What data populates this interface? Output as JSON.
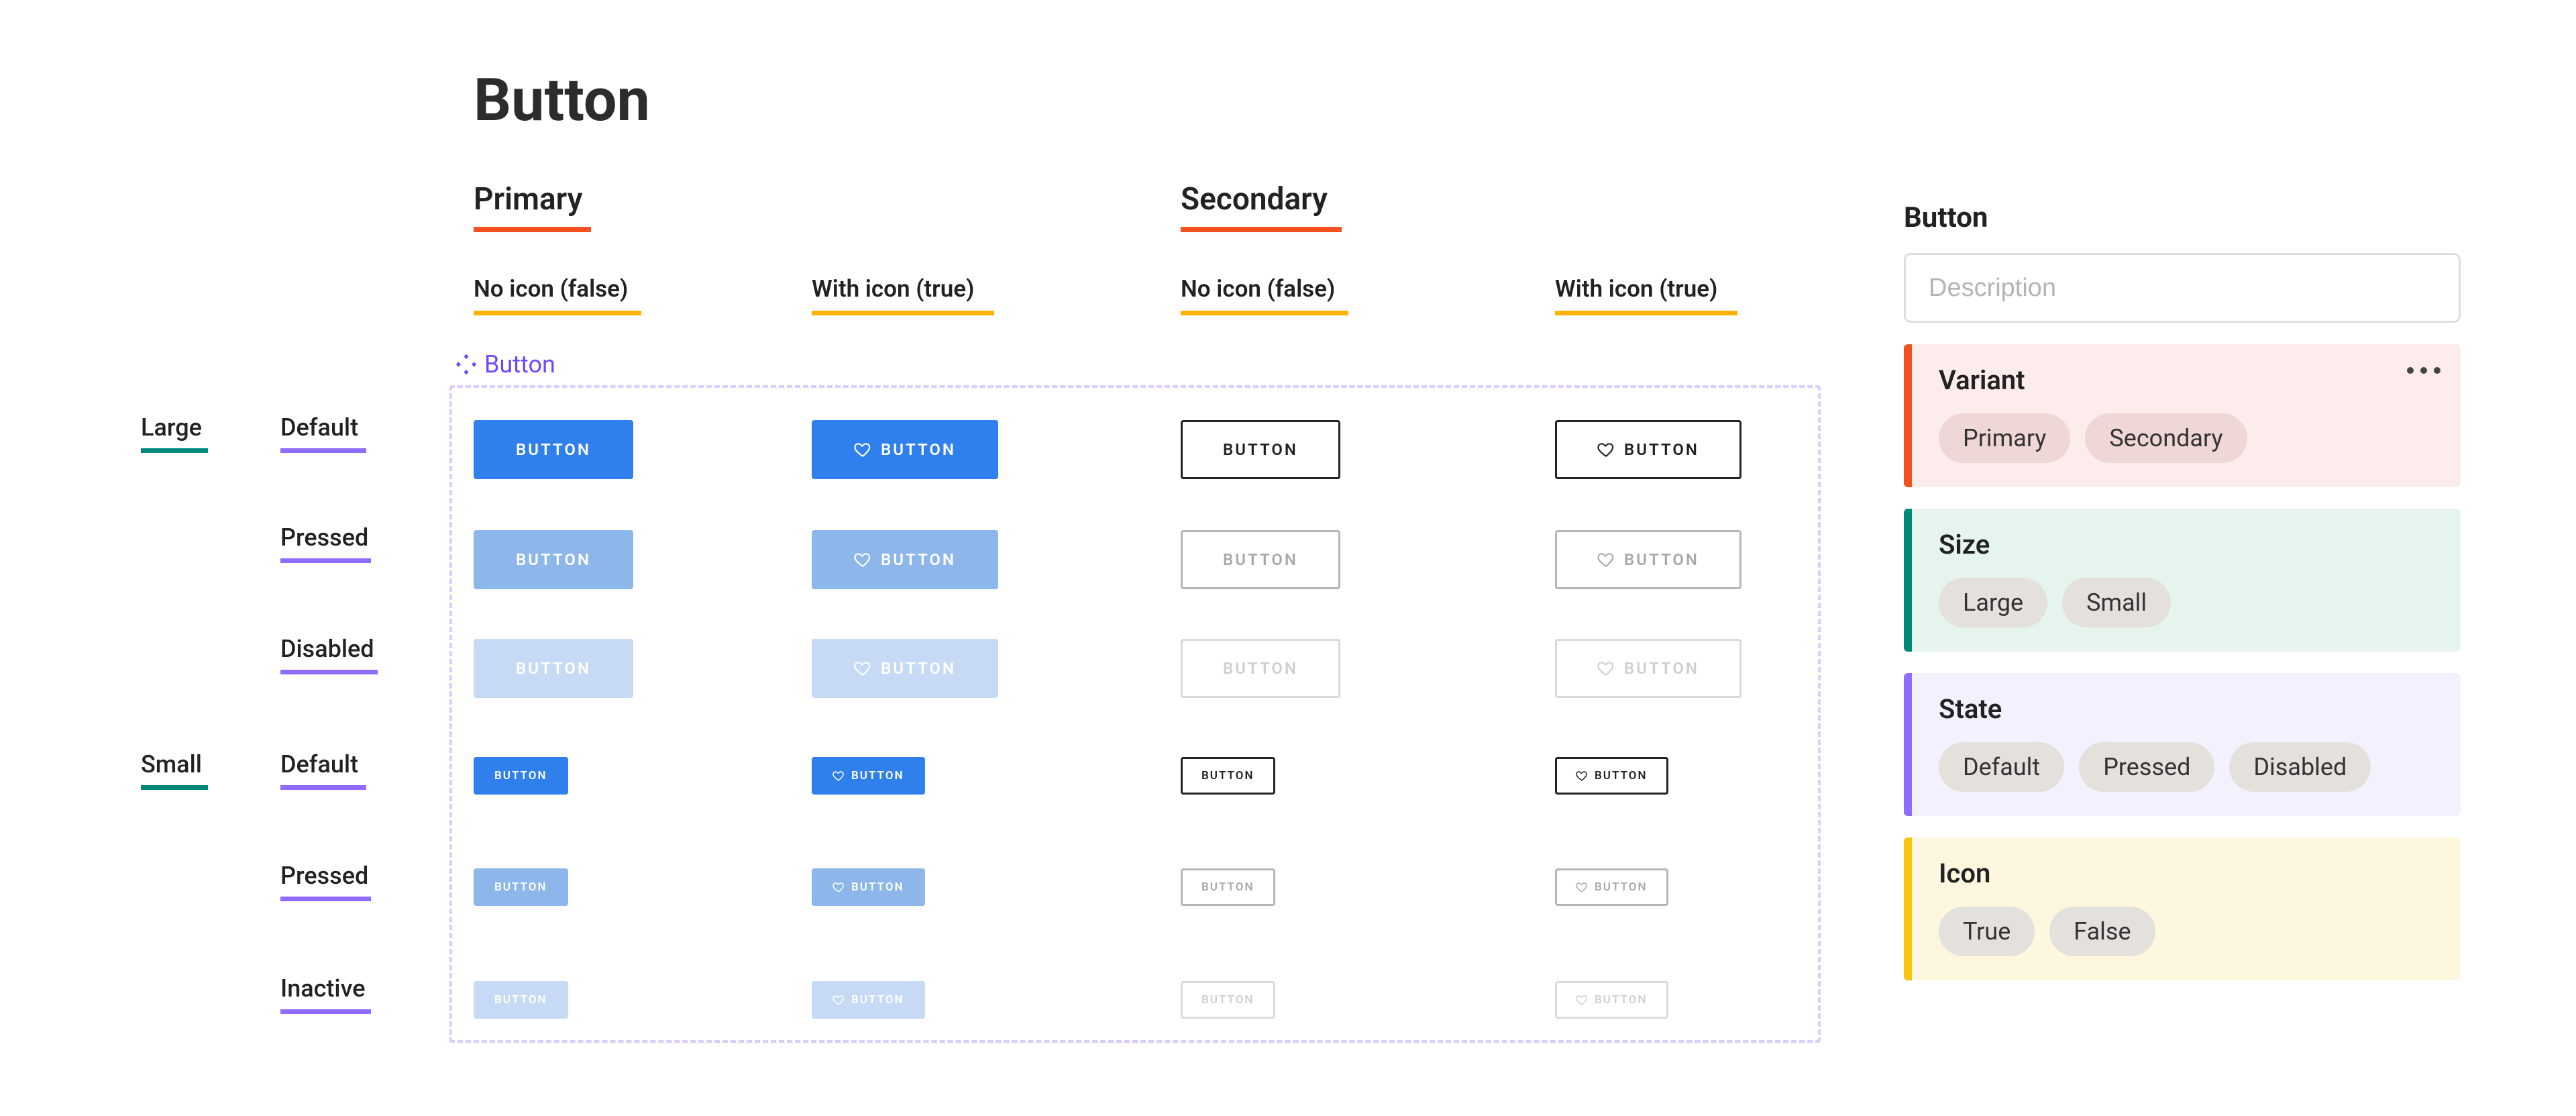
{
  "title": "Button",
  "columns": {
    "primary": {
      "head": "Primary",
      "no_icon": "No icon (false)",
      "with_icon": "With icon (true)"
    },
    "secondary": {
      "head": "Secondary",
      "no_icon": "No icon (false)",
      "with_icon": "With icon (true)"
    }
  },
  "rows": {
    "sizes": {
      "large": "Large",
      "small": "Small"
    },
    "states_large": [
      "Default",
      "Pressed",
      "Disabled"
    ],
    "states_small": [
      "Default",
      "Pressed",
      "Inactive"
    ]
  },
  "component_tag": "Button",
  "button_label": "BUTTON",
  "panel": {
    "title": "Button",
    "description_placeholder": "Description",
    "groups": {
      "variant": {
        "title": "Variant",
        "chips": [
          "Primary",
          "Secondary"
        ]
      },
      "size": {
        "title": "Size",
        "chips": [
          "Large",
          "Small"
        ]
      },
      "state": {
        "title": "State",
        "chips": [
          "Default",
          "Pressed",
          "Disabled"
        ]
      },
      "icon": {
        "title": "Icon",
        "chips": [
          "True",
          "False"
        ]
      }
    }
  }
}
